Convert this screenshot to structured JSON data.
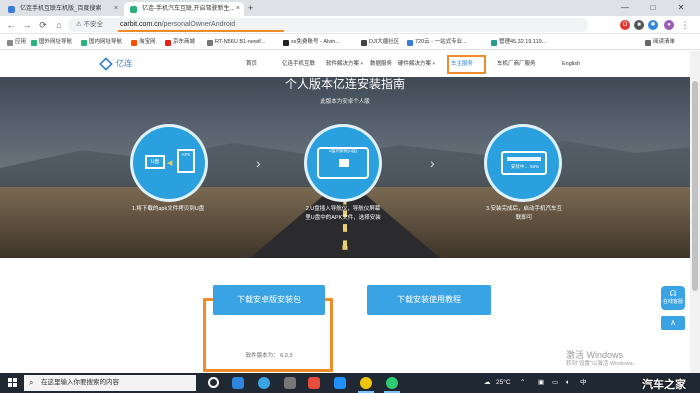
{
  "browser": {
    "tabs": [
      {
        "title": "亿连手机互联车机版_百度搜索",
        "active": false
      },
      {
        "title": "亿连-手机汽车互联,开启驾驶新生...",
        "active": true
      }
    ],
    "new_tab": "+",
    "security_label": "⚠ 不安全",
    "url_host": "carbit.com.cn",
    "url_path": "/personalOwnerAndroid",
    "window_controls": [
      "—",
      "□",
      "✕"
    ]
  },
  "bookmarks": [
    "应用",
    "国外网址导航",
    "国内网址导航",
    "淘宝网",
    "京东商城",
    "RT-N56U B1-newif...",
    "ss免费账号 - Alvin...",
    "DJI大疆社区",
    "720云 - 一站式专业...",
    "管理45.32.19.119...",
    "阅读清单"
  ],
  "site": {
    "logo": "亿连",
    "nav": [
      "首页",
      "亿连手机互联",
      "软件解决方案",
      "数据服务",
      "硬件解决方案",
      "车主服务",
      "车机厂商厂服务",
      "English"
    ],
    "hero_title": "个人版本亿连安装指南",
    "hero_subtitle": "此版本为安卓个人版",
    "steps": [
      {
        "caption": "1.将下载的apk文件拷贝到U盘",
        "icon": "usb-icon",
        "chip": "U盘",
        "chip2": "APK"
      },
      {
        "caption": "2.U盘插入导航仪，导航仪屏幕\n里U盘中的APK文件，选择安装",
        "icon": "install-icon",
        "chip": "U盘内安装(U盘)"
      },
      {
        "caption": "3.安装完成后，启动手机汽车互\n联即可",
        "icon": "progress-icon",
        "chip": "安装中… 50%"
      }
    ],
    "download_button": "下载安卓版安装包",
    "tutorial_button": "下载安装使用教程",
    "version_label": "软件版本为：",
    "version": "6.3.3",
    "float_service": "在线客服",
    "float_top": "∧"
  },
  "os": {
    "activate_title": "激活 Windows",
    "activate_sub": "转到\"设置\"以激活 Windows。",
    "search_placeholder": "在这里输入你要搜索的内容",
    "temperature": "25°C",
    "ime": "中",
    "watermark": "汽车之家"
  },
  "colors": {
    "highlight": "#f08c2a",
    "accent": "#3aa3e3",
    "brand": "#2d7fd3"
  }
}
